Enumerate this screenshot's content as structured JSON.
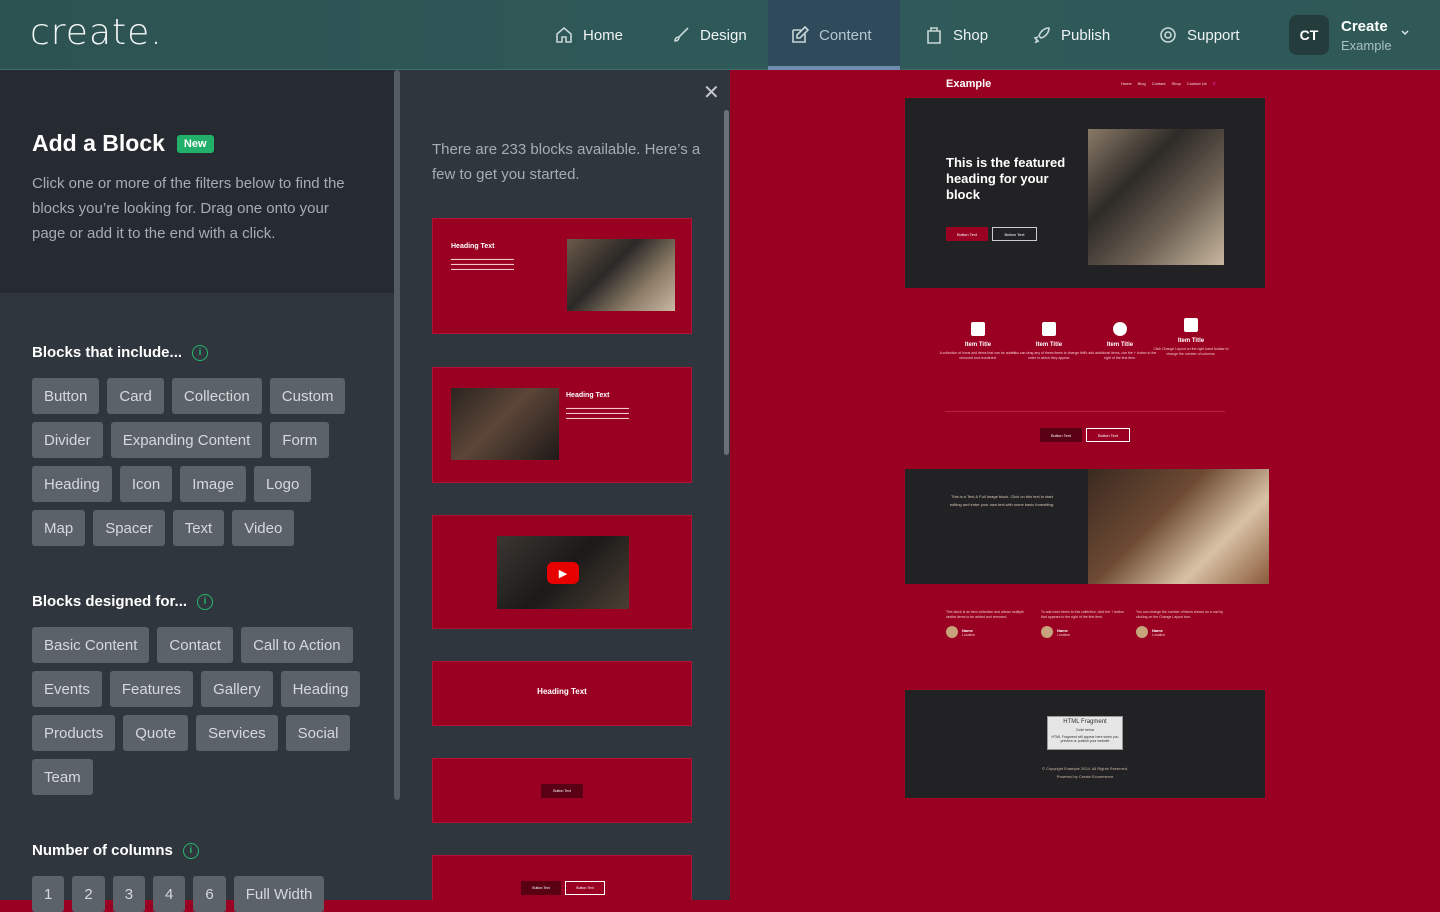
{
  "app": {
    "logo": "create."
  },
  "nav": [
    {
      "label": "Home",
      "icon": "home-icon"
    },
    {
      "label": "Design",
      "icon": "brush-icon"
    },
    {
      "label": "Content",
      "icon": "edit-icon"
    },
    {
      "label": "Shop",
      "icon": "bag-icon"
    },
    {
      "label": "Publish",
      "icon": "rocket-icon"
    },
    {
      "label": "Support",
      "icon": "lifebuoy-icon"
    }
  ],
  "user": {
    "initials": "CT",
    "name": "Create",
    "site": "Example"
  },
  "sidebar": {
    "title": "Add a Block",
    "badge": "New",
    "description": "Click one or more of the filters below to find the blocks you’re looking for. Drag one onto your page or add it to the end with a click.",
    "include_title": "Blocks that include...",
    "include_chips": [
      "Button",
      "Card",
      "Collection",
      "Custom",
      "Divider",
      "Expanding Content",
      "Form",
      "Heading",
      "Icon",
      "Image",
      "Logo",
      "Map",
      "Spacer",
      "Text",
      "Video"
    ],
    "designed_title": "Blocks designed for...",
    "designed_chips": [
      "Basic Content",
      "Contact",
      "Call to Action",
      "Events",
      "Features",
      "Gallery",
      "Heading",
      "Products",
      "Quote",
      "Services",
      "Social",
      "Team"
    ],
    "columns_title": "Number of columns",
    "columns_chips": [
      "1",
      "2",
      "3",
      "4",
      "6",
      "Full Width"
    ]
  },
  "blocks_panel": {
    "description": "There are 233 blocks available. Here’s a few to get you started.",
    "thumb1_heading": "Heading Text",
    "thumb2_heading": "Heading Text",
    "thumb4_heading": "Heading Text",
    "thumb5_button": "Button Text",
    "thumb6_button1": "Button Text",
    "thumb6_button2": "Button Text"
  },
  "preview": {
    "brand": "Example",
    "links": [
      "Home",
      "Blog",
      "Contact",
      "Shop",
      "Contact Us"
    ],
    "hero_heading": "This is the featured heading for your block",
    "hero_btn1": "Button Text",
    "hero_btn2": "Button Text",
    "features": [
      {
        "title": "Item Title",
        "text": "A collection of icons and items that can be added, removed and reordered."
      },
      {
        "title": "Item Title",
        "text": "You can drag any of these items to change the order in which they appear."
      },
      {
        "title": "Item Title",
        "text": "To add additional items, use the + button to the right of the first item."
      },
      {
        "title": "Item Title",
        "text": "Click Change Layout on the right hand toolbar to change the number of columns."
      }
    ],
    "mid_btn1": "Button Text",
    "mid_btn2": "Button Text",
    "text_image_copy": "This is a Text & Full Image block. Click on this text to start editing and enter your own text with some basic formatting.",
    "quotes": [
      {
        "text": "This block is an item collection and allows multiple similar items to be added and removed.",
        "name": "Name",
        "loc": "Location"
      },
      {
        "text": "To add more items to this collection, click the + button that appears to the right of the first item.",
        "name": "Name",
        "loc": "Location"
      },
      {
        "text": "You can change the number of items shown on a row by clicking on the Change Layout icon.",
        "name": "Name",
        "loc": "Location"
      }
    ],
    "fragment_title": "HTML Fragment",
    "fragment_sub": "Code below",
    "fragment_note": "HTML Fragment will appear here when you preview or publish your website",
    "copyright": "© Copyright Example 2024. All Rights Reserved.",
    "powered": "Powered by Create Ecommerce"
  }
}
